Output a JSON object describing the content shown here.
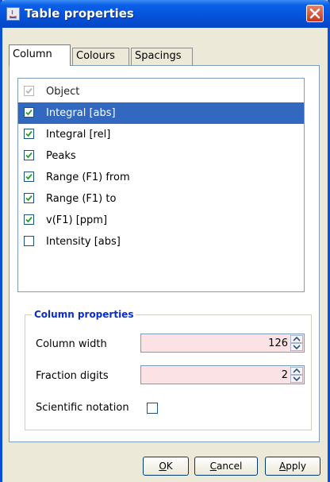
{
  "window": {
    "title": "Table properties"
  },
  "tabs": [
    {
      "label": "Column",
      "active": true
    },
    {
      "label": "Colours",
      "active": false
    },
    {
      "label": "Spacings",
      "active": false
    }
  ],
  "columns": [
    {
      "label": "Object",
      "checked": true,
      "disabled": true,
      "selected": false
    },
    {
      "label": "Integral [abs]",
      "checked": true,
      "disabled": false,
      "selected": true
    },
    {
      "label": "Integral [rel]",
      "checked": true,
      "disabled": false,
      "selected": false
    },
    {
      "label": "Peaks",
      "checked": true,
      "disabled": false,
      "selected": false
    },
    {
      "label": "Range (F1) from",
      "checked": true,
      "disabled": false,
      "selected": false
    },
    {
      "label": "Range (F1) to",
      "checked": true,
      "disabled": false,
      "selected": false
    },
    {
      "label": "v(F1) [ppm]",
      "checked": true,
      "disabled": false,
      "selected": false
    },
    {
      "label": "Intensity [abs]",
      "checked": false,
      "disabled": false,
      "selected": false
    }
  ],
  "column_properties": {
    "title": "Column properties",
    "column_width_label": "Column width",
    "column_width_value": "126",
    "fraction_digits_label": "Fraction digits",
    "fraction_digits_value": "2",
    "scientific_notation_label": "Scientific notation",
    "scientific_notation_checked": false
  },
  "buttons": {
    "ok_mnemonic": "O",
    "ok_rest": "K",
    "cancel_mnemonic": "C",
    "cancel_rest": "ancel",
    "apply_mnemonic": "A",
    "apply_rest": "pply"
  },
  "colors": {
    "selection": "#3268bf",
    "spinner_bg": "#fbe3e5",
    "group_title": "#0b2ec9",
    "check_green": "#21a121"
  }
}
